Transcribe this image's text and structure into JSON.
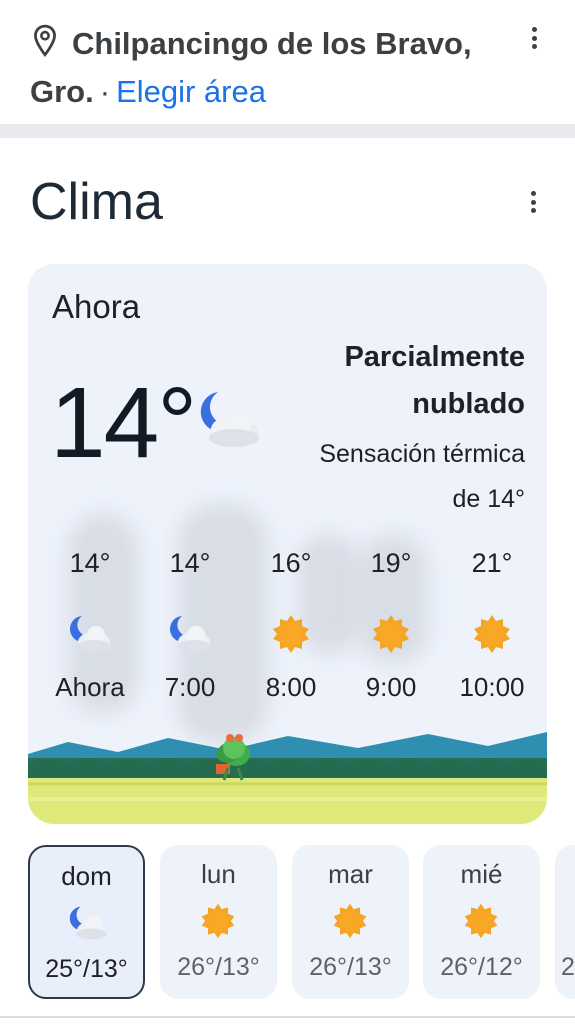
{
  "location": {
    "name": "Chilpancingo de los Bravo,",
    "state": "Gro.",
    "separator": "·",
    "choose_area": "Elegir área"
  },
  "weather": {
    "title": "Clima",
    "now_label": "Ahora",
    "temperature": "14°",
    "condition_line1": "Parcialmente",
    "condition_line2": "nublado",
    "feels_line1": "Sensación térmica",
    "feels_line2": "de 14°",
    "condition_icon": "partly-cloudy-night-icon",
    "hourly": [
      {
        "temp": "14°",
        "time": "Ahora",
        "icon": "partly-cloudy-night-icon"
      },
      {
        "temp": "14°",
        "time": "7:00",
        "icon": "partly-cloudy-night-icon"
      },
      {
        "temp": "16°",
        "time": "8:00",
        "icon": "sun-icon"
      },
      {
        "temp": "19°",
        "time": "9:00",
        "icon": "sun-icon"
      },
      {
        "temp": "21°",
        "time": "10:00",
        "icon": "sun-icon"
      }
    ],
    "daily": [
      {
        "day": "dom",
        "range": "25°/13°",
        "icon": "partly-cloudy-night-icon",
        "selected": true
      },
      {
        "day": "lun",
        "range": "26°/13°",
        "icon": "sun-icon",
        "selected": false
      },
      {
        "day": "mar",
        "range": "26°/13°",
        "icon": "sun-icon",
        "selected": false
      },
      {
        "day": "mié",
        "range": "26°/12°",
        "icon": "sun-icon",
        "selected": false
      },
      {
        "day": "",
        "range": "2",
        "icon": "",
        "selected": false
      }
    ]
  },
  "colors": {
    "link": "#1a73e8",
    "sun": "#f5a524",
    "moon": "#3b6fe0",
    "card": "#edf2fb"
  }
}
